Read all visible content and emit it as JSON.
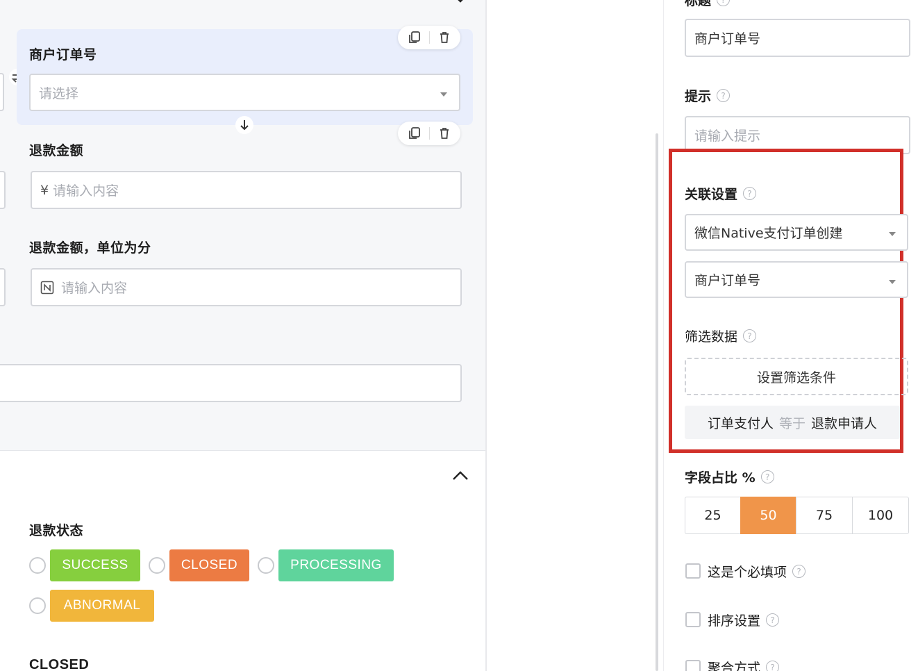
{
  "left": {
    "fields": [
      {
        "label": "商户订单号",
        "placeholder": "请选择"
      },
      {
        "label": "退款金额",
        "prefix": "¥",
        "placeholder": "请输入内容"
      },
      {
        "label": "退款金额，单位为分",
        "placeholder": "请输入内容"
      }
    ],
    "status_section": {
      "label": "退款状态",
      "options": [
        {
          "text": "SUCCESS",
          "color": "#86cf3e"
        },
        {
          "text": "CLOSED",
          "color": "#ec7b43"
        },
        {
          "text": "PROCESSING",
          "color": "#5fd49c"
        },
        {
          "text": "ABNORMAL",
          "color": "#f1b63b"
        }
      ],
      "footer_label": "CLOSED"
    }
  },
  "right": {
    "title_label": "标题",
    "title_value": "商户订单号",
    "hint_label": "提示",
    "hint_placeholder": "请输入提示",
    "relation": {
      "label": "关联设置",
      "source_value": "微信Native支付订单创建",
      "field_value": "商户订单号",
      "filter_label": "筛选数据",
      "filter_button": "设置筛选条件",
      "condition": {
        "left": "订单支付人",
        "op": "等于",
        "right": "退款申请人"
      },
      "highlight_color": "#d1302a"
    },
    "width_ratio": {
      "label": "字段占比 %",
      "options": [
        "25",
        "50",
        "75",
        "100"
      ],
      "selected": "50",
      "accent": "#f0954a"
    },
    "checks": [
      {
        "label": "这是个必填项"
      },
      {
        "label": "排序设置"
      },
      {
        "label": "聚合方式"
      }
    ]
  }
}
